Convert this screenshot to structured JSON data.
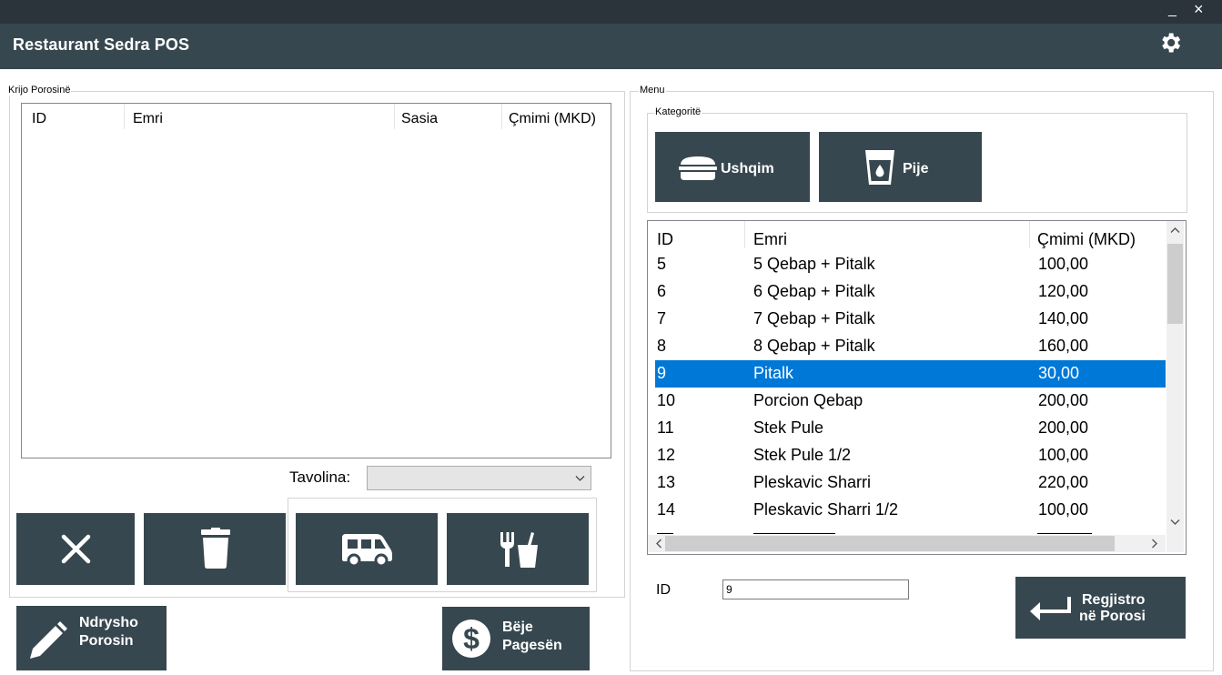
{
  "window": {
    "title": "Restaurant Sedra POS",
    "minimize_glyph": "_",
    "close_glyph": "×",
    "settings_icon": "gear-icon"
  },
  "order_panel": {
    "group_label": "Krijo Porosinë",
    "columns": [
      "ID",
      "Emri",
      "Sasia",
      "Çmimi (MKD)"
    ],
    "rows": [],
    "table_label": "Tavolina:",
    "table_value": "",
    "buttons": {
      "cancel_icon": "close-icon",
      "delete_icon": "trash-icon",
      "delivery_icon": "van-icon",
      "dine_in_icon": "fork-drink-icon"
    }
  },
  "edit_order": {
    "line1": "Ndrysho",
    "line2": "Porosin",
    "icon": "pencil-icon"
  },
  "make_payment": {
    "line1": "Bëje",
    "line2": "Pagesën",
    "icon": "dollar-icon"
  },
  "menu_panel": {
    "group_label": "Menu",
    "categories_label": "Kategoritë",
    "categories": [
      {
        "label": "Ushqim",
        "icon": "burger-icon"
      },
      {
        "label": "Pije",
        "icon": "cup-icon"
      }
    ],
    "columns": [
      "ID",
      "Emri",
      "Çmimi (MKD)"
    ],
    "items": [
      {
        "id": "5",
        "name": "5 Qebap + Pitalk",
        "price": "100,00"
      },
      {
        "id": "6",
        "name": "6 Qebap + Pitalk",
        "price": "120,00"
      },
      {
        "id": "7",
        "name": "7 Qebap + Pitalk",
        "price": "140,00"
      },
      {
        "id": "8",
        "name": "8 Qebap + Pitalk",
        "price": "160,00"
      },
      {
        "id": "9",
        "name": "Pitalk",
        "price": "30,00",
        "selected": true
      },
      {
        "id": "10",
        "name": "Porcion Qebap",
        "price": "200,00"
      },
      {
        "id": "11",
        "name": "Stek Pule",
        "price": "200,00"
      },
      {
        "id": "12",
        "name": "Stek Pule 1/2",
        "price": "100,00"
      },
      {
        "id": "13",
        "name": "Pleskavic Sharri",
        "price": "220,00"
      },
      {
        "id": "14",
        "name": "Pleskavic Sharri 1/2",
        "price": "100,00"
      }
    ],
    "id_label": "ID",
    "id_value": "9",
    "register_line1": "Regjistro",
    "register_line2": "në Porosi",
    "register_icon": "enter-arrow-icon"
  },
  "colors": {
    "dark": "#37474f",
    "topstrip": "#2b333b",
    "selection": "#0078d7"
  }
}
